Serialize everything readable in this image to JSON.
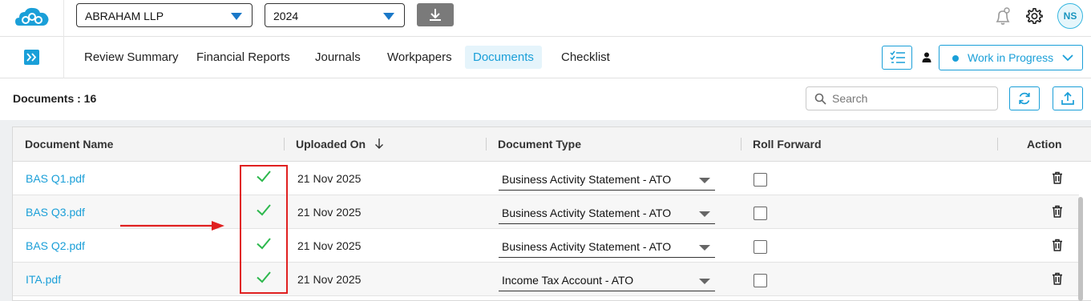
{
  "topbar": {
    "client": "ABRAHAM LLP",
    "year": "2024",
    "user_initials": "NS"
  },
  "nav": {
    "tabs": [
      {
        "label": "Review Summary"
      },
      {
        "label": "Financial Reports"
      },
      {
        "label": "Journals"
      },
      {
        "label": "Workpapers"
      },
      {
        "label": "Documents",
        "active": true
      },
      {
        "label": "Checklist"
      }
    ],
    "status": "Work in Progress"
  },
  "docs": {
    "count_label": "Documents : 16",
    "search_placeholder": "Search"
  },
  "table": {
    "columns": [
      "Document Name",
      "Uploaded On",
      "Document Type",
      "Roll Forward",
      "Action"
    ],
    "sort_icon": "arrow-down-icon",
    "rows": [
      {
        "name": "BAS Q1.pdf",
        "uploaded": "21 Nov 2025",
        "type": "Business Activity Statement - ATO",
        "roll_forward": false,
        "verified": true
      },
      {
        "name": "BAS Q3.pdf",
        "uploaded": "21 Nov 2025",
        "type": "Business Activity Statement - ATO",
        "roll_forward": false,
        "verified": true
      },
      {
        "name": "BAS Q2.pdf",
        "uploaded": "21 Nov 2025",
        "type": "Business Activity Statement - ATO",
        "roll_forward": false,
        "verified": true
      },
      {
        "name": "ITA.pdf",
        "uploaded": "21 Nov 2025",
        "type": "Income Tax Account - ATO",
        "roll_forward": false,
        "verified": true
      }
    ]
  },
  "colors": {
    "accent": "#1a9fd8",
    "check": "#2db84d",
    "annotation": "#e02020"
  }
}
